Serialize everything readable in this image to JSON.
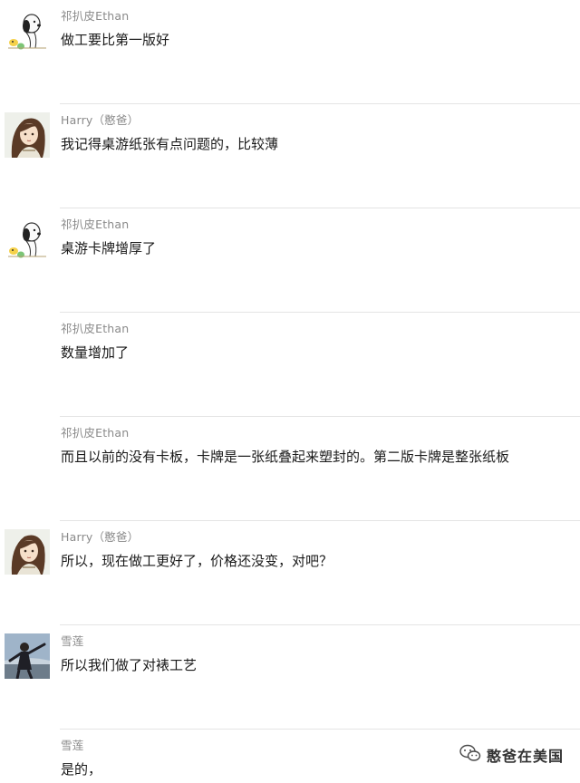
{
  "messages": [
    {
      "sender": "祁扒皮Ethan",
      "text": "做工要比第一版好",
      "avatar": "snoopy-avatar"
    },
    {
      "sender": "Harry（憨爸）",
      "text": "我记得桌游纸张有点问题的，比较薄",
      "avatar": "anime-avatar"
    },
    {
      "sender": "祁扒皮Ethan",
      "text": "桌游卡牌增厚了",
      "avatar": "snoopy-avatar"
    },
    {
      "sender": "祁扒皮Ethan",
      "text": "数量增加了",
      "avatar": null
    },
    {
      "sender": "祁扒皮Ethan",
      "text": "而且以前的没有卡板，卡牌是一张纸叠起来塑封的。第二版卡牌是整张纸板",
      "avatar": null
    },
    {
      "sender": "Harry（憨爸）",
      "text": "所以，现在做工更好了，价格还没变，对吧？",
      "avatar": "anime-avatar"
    },
    {
      "sender": "雪莲",
      "text": "所以我们做了对裱工艺",
      "avatar": "photo-avatar"
    },
    {
      "sender": "雪莲",
      "text": "是的，",
      "avatar": null
    }
  ],
  "watermark": {
    "text": "憨爸在美国",
    "icon": "wechat-icon"
  }
}
